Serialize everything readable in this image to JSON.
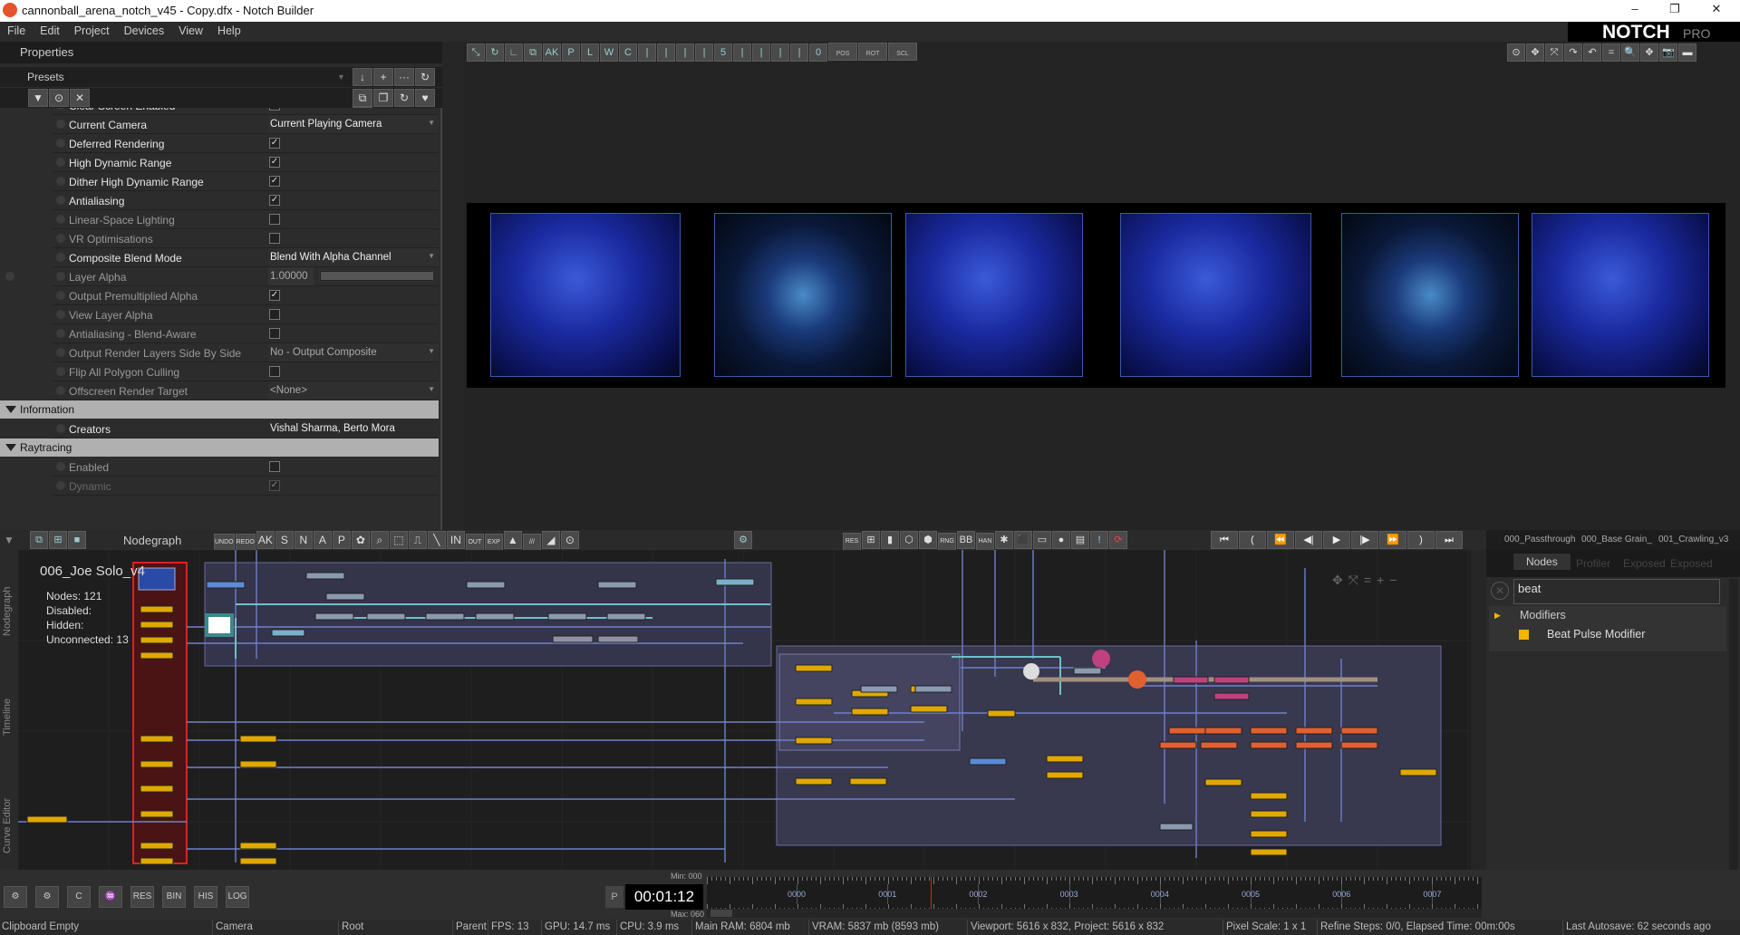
{
  "window": {
    "title": "cannonball_arena_notch_v45 - Copy.dfx - Notch Builder",
    "minimize": "–",
    "maximize": "❐",
    "close": "✕"
  },
  "menu": [
    "File",
    "Edit",
    "Project",
    "Devices",
    "View",
    "Help"
  ],
  "brand": {
    "logo": "NOTCH",
    "edition": "PRO",
    "accent": "#e5532a"
  },
  "properties": {
    "title": "Properties",
    "presets_label": "Presets",
    "preset_buttons": [
      "↓",
      "+",
      "···",
      "↻"
    ],
    "filter_buttons": [
      "▼",
      "⊙",
      "✕"
    ],
    "action_buttons": [
      "⧉",
      "❐",
      "↻",
      "♥",
      "?"
    ],
    "rows": [
      {
        "label": "Clear Screen Enabled",
        "type": "check",
        "checked": true,
        "dim": false
      },
      {
        "label": "Current Camera",
        "type": "select",
        "value": "Current Playing Camera",
        "dim": false
      },
      {
        "label": "Deferred Rendering",
        "type": "check",
        "checked": true,
        "dim": false
      },
      {
        "label": "High Dynamic Range",
        "type": "check",
        "checked": true,
        "dim": false
      },
      {
        "label": "Dither High Dynamic Range",
        "type": "check",
        "checked": true,
        "dim": false
      },
      {
        "label": "Antialiasing",
        "type": "check",
        "checked": true,
        "dim": false
      },
      {
        "label": "Linear-Space Lighting",
        "type": "check",
        "checked": false,
        "dim": true
      },
      {
        "label": "VR Optimisations",
        "type": "check",
        "checked": false,
        "dim": true
      },
      {
        "label": "Composite Blend Mode",
        "type": "select",
        "value": "Blend With Alpha Channel",
        "dim": false
      },
      {
        "label": "Layer Alpha",
        "type": "number",
        "value": "1.00000",
        "slider": 1.0,
        "dim": true
      },
      {
        "label": "Output Premultiplied Alpha",
        "type": "check",
        "checked": true,
        "dim": true
      },
      {
        "label": "View Layer Alpha",
        "type": "check",
        "checked": false,
        "dim": true
      },
      {
        "label": "Antialiasing - Blend-Aware",
        "type": "check",
        "checked": false,
        "dim": true
      },
      {
        "label": "Output Render Layers Side By Side",
        "type": "select",
        "value": "No - Output Composite",
        "dim": true
      },
      {
        "label": "Flip All Polygon Culling",
        "type": "check",
        "checked": false,
        "dim": true
      },
      {
        "label": "Offscreen Render Target",
        "type": "select",
        "value": "<None>",
        "dim": true
      },
      {
        "section": "Information"
      },
      {
        "label": "Creators",
        "type": "text",
        "value": "Vishal Sharma, Berto Mora",
        "dim": false
      },
      {
        "section": "Raytracing"
      },
      {
        "label": "Enabled",
        "type": "check",
        "checked": false,
        "dim": true
      },
      {
        "label": "Dynamic",
        "type": "check",
        "checked": true,
        "dim": true,
        "disabled": true
      }
    ]
  },
  "viewport": {
    "toolbar": [
      "⤡",
      "↻",
      "∟",
      "⧉",
      "AK",
      "P",
      "L",
      "W",
      "C",
      "|",
      "|",
      "|",
      "|",
      "5",
      "|",
      "|",
      "|",
      "|",
      "0"
    ],
    "locks": [
      "POS",
      "ROT",
      "SCL"
    ],
    "right_toolbar": [
      "⊙",
      "✥",
      "⤧",
      "↷",
      "↶",
      "=",
      "🔍",
      "✥",
      "📷",
      "▬"
    ],
    "thumbnails": [
      "figure",
      "particles",
      "figure",
      "figure",
      "particles",
      "figure"
    ]
  },
  "nodegraph": {
    "title": "Nodegraph",
    "toolbar": [
      "UNDO",
      "REDO",
      "AK",
      "S",
      "N",
      "A",
      "P",
      "✿",
      "⌕",
      "⬚",
      "⎍",
      "╲",
      "IN",
      "OUT",
      "EXP",
      "▲",
      "///",
      "◢",
      "⊙"
    ],
    "mid_toolbar": [
      "RES",
      "⊞",
      "▮",
      "⬡",
      "⬢",
      "RNG",
      "BB",
      "HAN",
      "✱",
      "⬛",
      "▭",
      "●",
      "▤",
      "!",
      "⟳"
    ],
    "transport": [
      "⏮",
      "(",
      "⏪",
      "◀|",
      "▶",
      "|▶",
      "⏩",
      ")",
      "⏭"
    ],
    "side_tabs": [
      "Nodegraph",
      "Timeline",
      "Curve Editor"
    ],
    "info": {
      "name": "006_Joe  Solo_v4",
      "nodes_label": "Nodes:",
      "nodes": "121",
      "disabled_label": "Disabled:",
      "hidden_label": "Hidden:",
      "unconnected_label": "Unconnected:",
      "unconnected": "13"
    }
  },
  "right_panel": {
    "layer_tabs": [
      "000_Passthrough",
      "000_Base Grain_",
      "001_Crawling_v3"
    ],
    "tabs": [
      "Nodes",
      "Profiler",
      "Exposed",
      "Exposed"
    ],
    "search_value": "beat",
    "tree": {
      "category": "Modifiers",
      "item": "Beat Pulse Modifier",
      "item_color": "#f5b400"
    }
  },
  "bottom": {
    "buttons": [
      "⚙",
      "⚙",
      "C",
      "♒",
      "RES",
      "BIN",
      "HIS",
      "LOG"
    ],
    "play_mode": "P",
    "time": "00:01:12",
    "min_label": "Min: 000",
    "max_label": "Max: 060",
    "ticks": [
      "0000",
      "0001",
      "0002",
      "0003",
      "0004",
      "0005",
      "0006",
      "0007"
    ]
  },
  "status": [
    "Clipboard Empty",
    "Camera",
    "Root",
    "Parent",
    "FPS: 13",
    "GPU: 14.7 ms",
    "CPU: 3.9 ms",
    "Main RAM: 6804 mb",
    "VRAM: 5837 mb (8593 mb)",
    "Viewport: 5616 x 832, Project: 5616 x 832",
    "Pixel Scale: 1 x 1",
    "Refine Steps: 0/0, Elapsed Time: 00m:00s",
    "Last Autosave: 62 seconds ago"
  ]
}
